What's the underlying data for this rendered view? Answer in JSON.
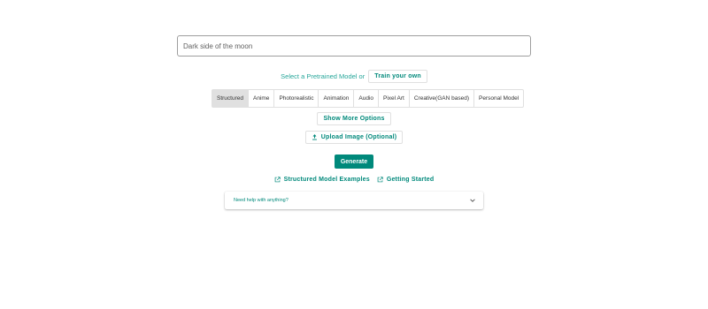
{
  "prompt": {
    "value": "Dark side of the moon"
  },
  "model_select": {
    "label": "Select a Pretrained Model or",
    "train_button": "Train your own"
  },
  "tabs": [
    {
      "label": "Structured",
      "active": true
    },
    {
      "label": "Anime",
      "active": false
    },
    {
      "label": "Photorealistic",
      "active": false
    },
    {
      "label": "Animation",
      "active": false
    },
    {
      "label": "Audio",
      "active": false
    },
    {
      "label": "Pixel Art",
      "active": false
    },
    {
      "label": "Creative(GAN based)",
      "active": false
    },
    {
      "label": "Personal Model",
      "active": false
    }
  ],
  "buttons": {
    "show_more": "Show More Options",
    "upload": "Upload Image (Optional)",
    "upload_icon": "upload-icon",
    "generate": "Generate"
  },
  "links": {
    "examples": "Structured Model Examples",
    "getting_started": "Getting Started",
    "icon": "external-link-icon"
  },
  "help": {
    "text": "Need help with anything?",
    "icon": "chevron-down-icon"
  },
  "colors": {
    "accent": "#00897b",
    "accent_light": "#26a69a",
    "active_tab": "#e0e0e0"
  }
}
